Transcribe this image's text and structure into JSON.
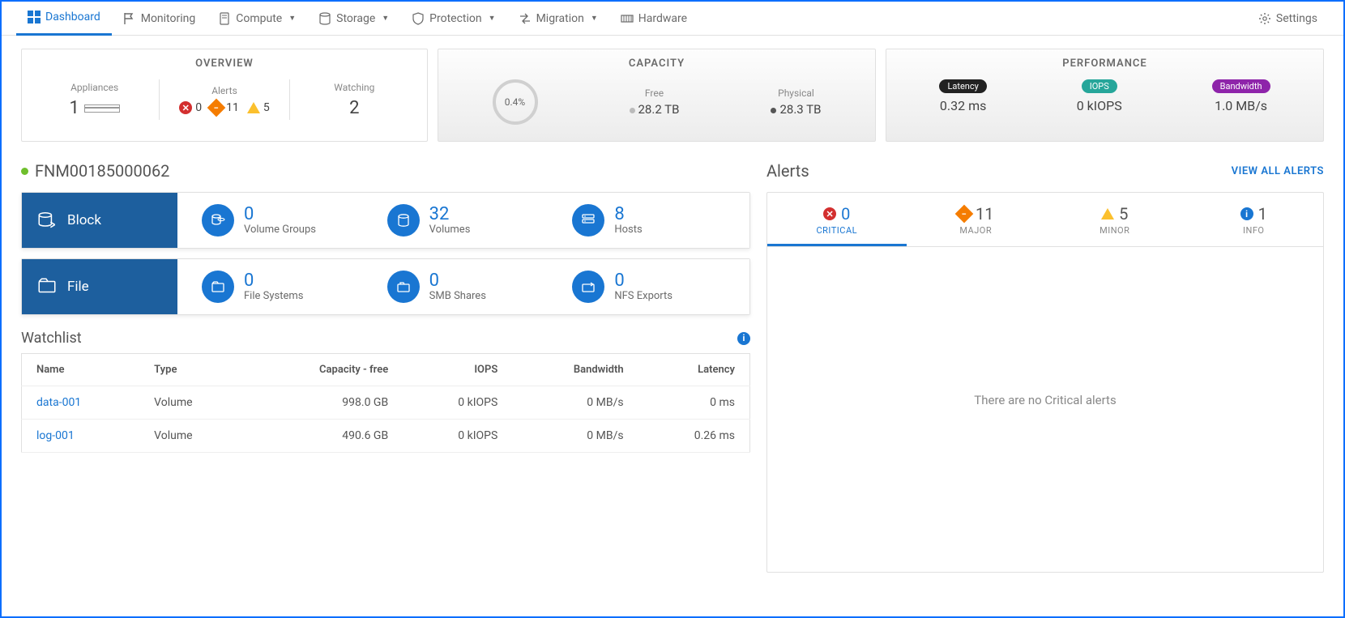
{
  "nav": {
    "dashboard": "Dashboard",
    "monitoring": "Monitoring",
    "compute": "Compute",
    "storage": "Storage",
    "protection": "Protection",
    "migration": "Migration",
    "hardware": "Hardware",
    "settings": "Settings"
  },
  "overview": {
    "title": "OVERVIEW",
    "appliances_label": "Appliances",
    "appliances_count": "1",
    "alerts_label": "Alerts",
    "critical": "0",
    "major": "11",
    "minor": "5",
    "watching_label": "Watching",
    "watching_count": "2"
  },
  "capacity": {
    "title": "CAPACITY",
    "percent": "0.4%",
    "free_label": "Free",
    "free_value": "28.2 TB",
    "physical_label": "Physical",
    "physical_value": "28.3 TB"
  },
  "performance": {
    "title": "PERFORMANCE",
    "latency_label": "Latency",
    "latency_value": "0.32 ms",
    "iops_label": "IOPS",
    "iops_value": "0 kIOPS",
    "bandwidth_label": "Bandwidth",
    "bandwidth_value": "1.0 MB/s"
  },
  "appliance": {
    "name": "FNM00185000062"
  },
  "block": {
    "title": "Block",
    "volume_groups": {
      "count": "0",
      "label": "Volume Groups"
    },
    "volumes": {
      "count": "32",
      "label": "Volumes"
    },
    "hosts": {
      "count": "8",
      "label": "Hosts"
    }
  },
  "file": {
    "title": "File",
    "file_systems": {
      "count": "0",
      "label": "File Systems"
    },
    "smb_shares": {
      "count": "0",
      "label": "SMB Shares"
    },
    "nfs_exports": {
      "count": "0",
      "label": "NFS Exports"
    }
  },
  "watchlist": {
    "title": "Watchlist",
    "columns": {
      "name": "Name",
      "type": "Type",
      "capacity": "Capacity - free",
      "iops": "IOPS",
      "bandwidth": "Bandwidth",
      "latency": "Latency"
    },
    "rows": [
      {
        "name": "data-001",
        "type": "Volume",
        "capacity": "998.0 GB",
        "iops": "0 kIOPS",
        "bandwidth": "0 MB/s",
        "latency": "0 ms"
      },
      {
        "name": "log-001",
        "type": "Volume",
        "capacity": "490.6 GB",
        "iops": "0 kIOPS",
        "bandwidth": "0 MB/s",
        "latency": "0.26 ms"
      }
    ]
  },
  "alerts": {
    "title": "Alerts",
    "view_all": "VIEW ALL ALERTS",
    "tabs": {
      "critical": {
        "count": "0",
        "label": "CRITICAL"
      },
      "major": {
        "count": "11",
        "label": "MAJOR"
      },
      "minor": {
        "count": "5",
        "label": "MINOR"
      },
      "info": {
        "count": "1",
        "label": "INFO"
      }
    },
    "empty": "There are no Critical alerts"
  }
}
